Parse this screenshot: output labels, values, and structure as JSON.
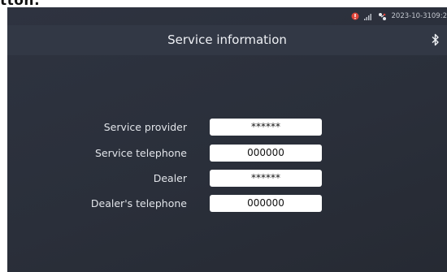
{
  "header_fragment": "tton:",
  "status_bar": {
    "datetime": "2023-10-3109:2"
  },
  "title_bar": {
    "title": "Service information"
  },
  "form": {
    "rows": [
      {
        "label": "Service provider",
        "value": "******"
      },
      {
        "label": "Service telephone",
        "value": "000000"
      },
      {
        "label": "Dealer",
        "value": "******"
      },
      {
        "label": "Dealer's telephone",
        "value": "000000"
      }
    ]
  },
  "icons": {
    "status": [
      "alert-icon",
      "signal-icon",
      "network-icon"
    ],
    "bluetooth": "bluetooth-icon"
  },
  "colors": {
    "background": "#2b303b",
    "title_bar": "#323845",
    "field_background": "#ffffff",
    "alert": "#e0453a"
  }
}
